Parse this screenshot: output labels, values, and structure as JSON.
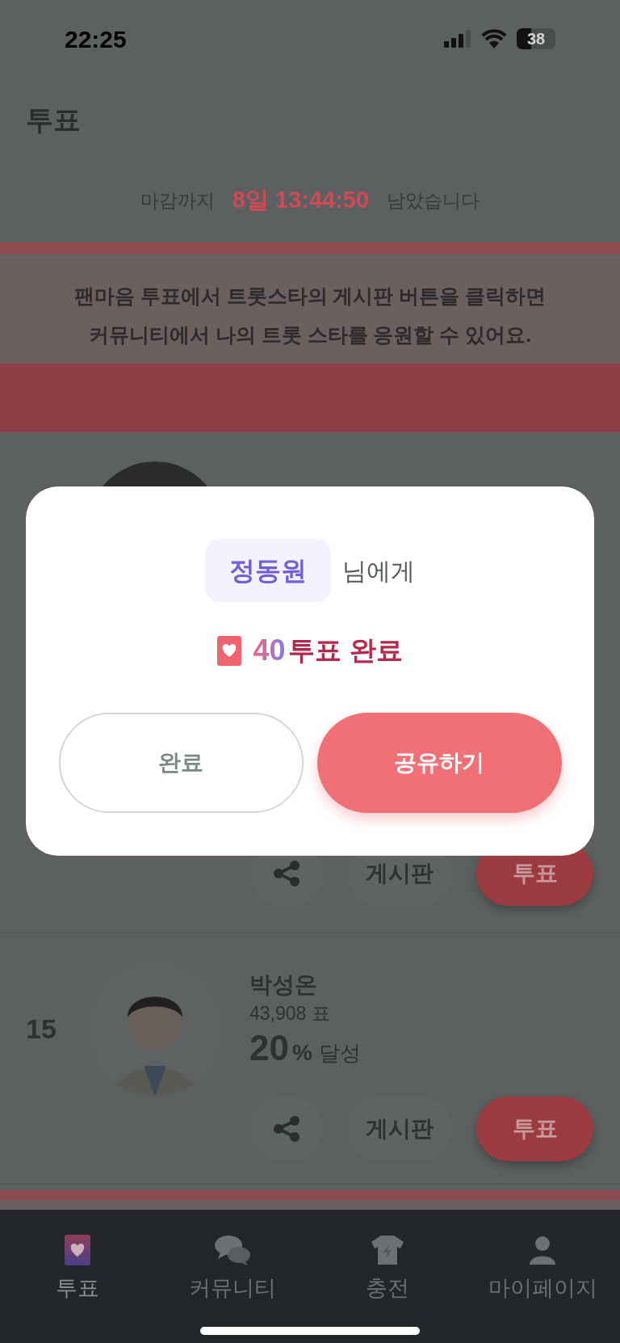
{
  "status_bar": {
    "time": "22:25",
    "battery": "38"
  },
  "header": {
    "title": "투표"
  },
  "deadline": {
    "prefix": "마감까지",
    "remaining": "8일 13:44:50",
    "suffix": "남았습니다"
  },
  "banner": {
    "lines": [
      "팬마음 투표에서 트롯스타의 게시판 버튼을 클릭하면",
      "커뮤니티에서 나의 트롯 스타를 응원할 수 있어요."
    ]
  },
  "candidates": [
    {
      "actions": [
        {
          "kind": "share"
        },
        {
          "kind": "board",
          "label": "게시판"
        },
        {
          "kind": "vote",
          "label": "투표"
        }
      ]
    },
    {
      "rank": "15",
      "name": "박성온",
      "votes": "43,908 표",
      "percent": "20",
      "percent_unit": "%",
      "percent_label": "달성",
      "actions": [
        {
          "kind": "share"
        },
        {
          "kind": "board",
          "label": "게시판"
        },
        {
          "kind": "vote",
          "label": "투표"
        }
      ]
    }
  ],
  "dialog": {
    "recipient": "정동원",
    "recipient_suffix": "님에게",
    "vote_count": "40",
    "vote_text": "투표 완료",
    "buttons": [
      {
        "kind": "secondary",
        "label": "완료"
      },
      {
        "kind": "primary",
        "label": "공유하기"
      }
    ]
  },
  "tab_bar": [
    {
      "kind": "vote",
      "label": "투표",
      "selected": true
    },
    {
      "kind": "community",
      "label": "커뮤니티",
      "selected": false
    },
    {
      "kind": "charge",
      "label": "충전",
      "selected": false
    },
    {
      "kind": "mypage",
      "label": "마이페이지",
      "selected": false
    }
  ]
}
